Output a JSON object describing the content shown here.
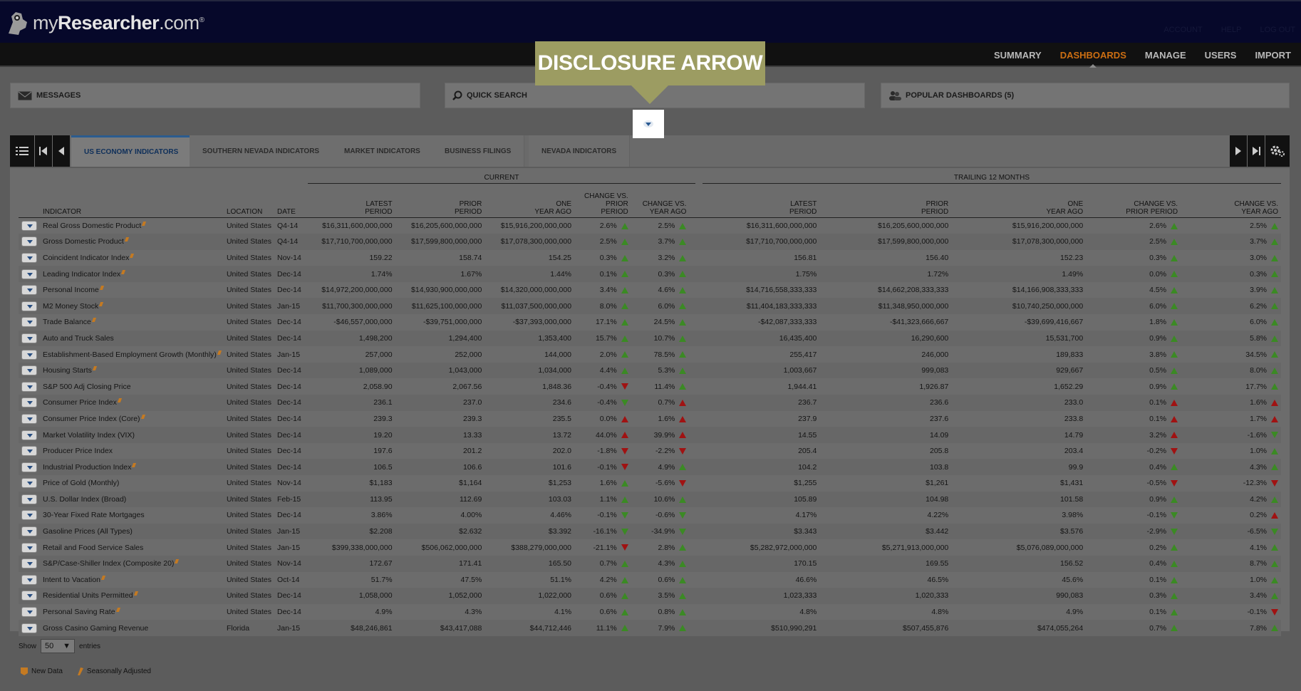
{
  "app": {
    "logo_text_1": "my",
    "logo_text_2": "Researcher",
    "logo_text_3": ".com",
    "logo_reg": "®"
  },
  "top_links": [
    "ACCOUNT",
    "HELP",
    "LOG OUT"
  ],
  "nav": [
    "SUMMARY",
    "DASHBOARDS",
    "MANAGE",
    "USERS",
    "IMPORT"
  ],
  "nav_active": "DASHBOARDS",
  "panels": {
    "messages": "MESSAGES",
    "quick_search": "QUICK SEARCH",
    "popular": "POPULAR DASHBOARDS (5)"
  },
  "callout": "DISCLOSURE ARROW",
  "tabs": [
    "US ECONOMY INDICATORS",
    "SOUTHERN NEVADA INDICATORS",
    "MARKET INDICATORS",
    "BUSINESS FILINGS",
    "NEVADA INDICATORS"
  ],
  "groups": {
    "current": "CURRENT",
    "trailing": "TRAILING 12 MONTHS"
  },
  "columns": {
    "indicator": "INDICATOR",
    "location": "LOCATION",
    "date": "DATE",
    "latest": [
      "LATEST",
      "PERIOD"
    ],
    "prior": [
      "PRIOR",
      "PERIOD"
    ],
    "one_year": [
      "ONE",
      "YEAR AGO"
    ],
    "chg_prior": [
      "CHANGE VS.",
      "PRIOR PERIOD"
    ],
    "chg_year": [
      "CHANGE VS.",
      "YEAR AGO"
    ]
  },
  "rows": [
    [
      "Real Gross Domestic Product",
      1,
      "United States",
      "Q4-14",
      "$16,311,600,000,000",
      "$16,205,600,000,000",
      "$15,916,200,000,000",
      "2.6%",
      "up",
      "2.5%",
      "up",
      "$16,311,600,000,000",
      "$16,205,600,000,000",
      "$15,916,200,000,000",
      "2.6%",
      "up",
      "2.5%",
      "up"
    ],
    [
      "Gross Domestic Product",
      1,
      "United States",
      "Q4-14",
      "$17,710,700,000,000",
      "$17,599,800,000,000",
      "$17,078,300,000,000",
      "2.5%",
      "up",
      "3.7%",
      "up",
      "$17,710,700,000,000",
      "$17,599,800,000,000",
      "$17,078,300,000,000",
      "2.5%",
      "up",
      "3.7%",
      "up"
    ],
    [
      "Coincident Indicator Index",
      1,
      "United States",
      "Nov-14",
      "159.22",
      "158.74",
      "154.25",
      "0.3%",
      "up",
      "3.2%",
      "up",
      "156.81",
      "156.40",
      "152.23",
      "0.3%",
      "up",
      "3.0%",
      "up"
    ],
    [
      "Leading Indicator Index",
      1,
      "United States",
      "Dec-14",
      "1.74%",
      "1.67%",
      "1.44%",
      "0.1%",
      "up",
      "0.3%",
      "up",
      "1.75%",
      "1.72%",
      "1.49%",
      "0.0%",
      "up",
      "0.3%",
      "up"
    ],
    [
      "Personal Income",
      1,
      "United States",
      "Dec-14",
      "$14,972,200,000,000",
      "$14,930,900,000,000",
      "$14,320,000,000,000",
      "3.4%",
      "up",
      "4.6%",
      "up",
      "$14,716,558,333,333",
      "$14,662,208,333,333",
      "$14,166,908,333,333",
      "4.5%",
      "up",
      "3.9%",
      "up"
    ],
    [
      "M2 Money Stock",
      1,
      "United States",
      "Jan-15",
      "$11,700,300,000,000",
      "$11,625,100,000,000",
      "$11,037,500,000,000",
      "8.0%",
      "up",
      "6.0%",
      "up",
      "$11,404,183,333,333",
      "$11,348,950,000,000",
      "$10,740,250,000,000",
      "6.0%",
      "up",
      "6.2%",
      "up"
    ],
    [
      "Trade Balance",
      1,
      "United States",
      "Dec-14",
      "-$46,557,000,000",
      "-$39,751,000,000",
      "-$37,393,000,000",
      "17.1%",
      "up",
      "24.5%",
      "up",
      "-$42,087,333,333",
      "-$41,323,666,667",
      "-$39,699,416,667",
      "1.8%",
      "up",
      "6.0%",
      "up"
    ],
    [
      "Auto and Truck Sales",
      0,
      "United States",
      "Dec-14",
      "1,498,200",
      "1,294,400",
      "1,353,400",
      "15.7%",
      "up",
      "10.7%",
      "up",
      "16,435,400",
      "16,290,600",
      "15,531,700",
      "0.9%",
      "up",
      "5.8%",
      "up"
    ],
    [
      "Establishment-Based Employment Growth (Monthly)",
      1,
      "United States",
      "Jan-15",
      "257,000",
      "252,000",
      "144,000",
      "2.0%",
      "up",
      "78.5%",
      "up",
      "255,417",
      "246,000",
      "189,833",
      "3.8%",
      "up",
      "34.5%",
      "up"
    ],
    [
      "Housing Starts",
      1,
      "United States",
      "Dec-14",
      "1,089,000",
      "1,043,000",
      "1,034,000",
      "4.4%",
      "up",
      "5.3%",
      "up",
      "1,003,667",
      "999,083",
      "929,667",
      "0.5%",
      "up",
      "8.0%",
      "up"
    ],
    [
      "S&P 500 Adj Closing Price",
      0,
      "United States",
      "Dec-14",
      "2,058.90",
      "2,067.56",
      "1,848.36",
      "-0.4%",
      "dn",
      "11.4%",
      "up",
      "1,944.41",
      "1,926.87",
      "1,652.29",
      "0.9%",
      "up",
      "17.7%",
      "up"
    ],
    [
      "Consumer Price Index",
      1,
      "United States",
      "Dec-14",
      "236.1",
      "237.0",
      "234.6",
      "-0.4%",
      "dng",
      "0.7%",
      "upr",
      "236.7",
      "236.6",
      "233.0",
      "0.1%",
      "upr",
      "1.6%",
      "upr"
    ],
    [
      "Consumer Price Index (Core)",
      1,
      "United States",
      "Dec-14",
      "239.3",
      "239.3",
      "235.5",
      "0.0%",
      "upr",
      "1.6%",
      "upr",
      "237.9",
      "237.6",
      "233.8",
      "0.1%",
      "upr",
      "1.7%",
      "upr"
    ],
    [
      "Market Volatility Index (VIX)",
      0,
      "United States",
      "Dec-14",
      "19.20",
      "13.33",
      "13.72",
      "44.0%",
      "upr",
      "39.9%",
      "upr",
      "14.55",
      "14.09",
      "14.79",
      "3.2%",
      "upr",
      "-1.6%",
      "dng"
    ],
    [
      "Producer Price Index",
      0,
      "United States",
      "Dec-14",
      "197.6",
      "201.2",
      "202.0",
      "-1.8%",
      "dn",
      "-2.2%",
      "dn",
      "205.4",
      "205.8",
      "203.4",
      "-0.2%",
      "dn",
      "1.0%",
      "up"
    ],
    [
      "Industrial Production Index",
      1,
      "United States",
      "Dec-14",
      "106.5",
      "106.6",
      "101.6",
      "-0.1%",
      "dn",
      "4.9%",
      "up",
      "104.2",
      "103.8",
      "99.9",
      "0.4%",
      "up",
      "4.3%",
      "up"
    ],
    [
      "Price of Gold (Monthly)",
      0,
      "United States",
      "Nov-14",
      "$1,183",
      "$1,164",
      "$1,253",
      "1.6%",
      "up",
      "-5.6%",
      "dn",
      "$1,255",
      "$1,261",
      "$1,431",
      "-0.5%",
      "dn",
      "-12.3%",
      "dn"
    ],
    [
      "U.S. Dollar Index (Broad)",
      0,
      "United States",
      "Feb-15",
      "113.95",
      "112.69",
      "103.03",
      "1.1%",
      "up",
      "10.6%",
      "up",
      "105.89",
      "104.98",
      "101.58",
      "0.9%",
      "up",
      "4.2%",
      "up"
    ],
    [
      "30-Year Fixed Rate Mortgages",
      0,
      "United States",
      "Dec-14",
      "3.86%",
      "4.00%",
      "4.46%",
      "-0.1%",
      "dng",
      "-0.6%",
      "dng",
      "4.17%",
      "4.22%",
      "3.98%",
      "-0.1%",
      "dng",
      "0.2%",
      "upr"
    ],
    [
      "Gasoline Prices (All Types)",
      0,
      "United States",
      "Jan-15",
      "$2.208",
      "$2.632",
      "$3.392",
      "-16.1%",
      "dng",
      "-34.9%",
      "dng",
      "$3.343",
      "$3.442",
      "$3.576",
      "-2.9%",
      "dng",
      "-6.5%",
      "dng"
    ],
    [
      "Retail and Food Service Sales",
      0,
      "United States",
      "Jan-15",
      "$399,338,000,000",
      "$506,062,000,000",
      "$388,279,000,000",
      "-21.1%",
      "dn",
      "2.8%",
      "up",
      "$5,282,972,000,000",
      "$5,271,913,000,000",
      "$5,076,089,000,000",
      "0.2%",
      "up",
      "4.1%",
      "up"
    ],
    [
      "S&P/Case-Shiller Index (Composite 20)",
      1,
      "United States",
      "Nov-14",
      "172.67",
      "171.41",
      "165.50",
      "0.7%",
      "up",
      "4.3%",
      "up",
      "170.15",
      "169.55",
      "156.52",
      "0.4%",
      "up",
      "8.7%",
      "up"
    ],
    [
      "Intent to Vacation",
      1,
      "United States",
      "Oct-14",
      "51.7%",
      "47.5%",
      "51.1%",
      "4.2%",
      "up",
      "0.6%",
      "up",
      "46.6%",
      "46.5%",
      "45.6%",
      "0.1%",
      "up",
      "1.0%",
      "up"
    ],
    [
      "Residential Units Permitted",
      1,
      "United States",
      "Dec-14",
      "1,058,000",
      "1,052,000",
      "1,022,000",
      "0.6%",
      "up",
      "3.5%",
      "up",
      "1,023,333",
      "1,020,333",
      "990,083",
      "0.3%",
      "up",
      "3.4%",
      "up"
    ],
    [
      "Personal Saving Rate",
      1,
      "United States",
      "Dec-14",
      "4.9%",
      "4.3%",
      "4.1%",
      "0.6%",
      "up",
      "0.8%",
      "up",
      "4.8%",
      "4.8%",
      "4.9%",
      "0.1%",
      "up",
      "-0.1%",
      "dn"
    ],
    [
      "Gross Casino Gaming Revenue",
      0,
      "Florida",
      "Jan-15",
      "$48,246,861",
      "$43,417,088",
      "$44,712,446",
      "11.1%",
      "up",
      "7.9%",
      "up",
      "$510,990,291",
      "$507,455,876",
      "$474,055,264",
      "0.7%",
      "up",
      "7.8%",
      "up"
    ]
  ],
  "show": {
    "label_before": "Show",
    "value": "50",
    "label_after": "entries"
  },
  "legend": {
    "new_data": "New Data",
    "seasonally": "Seasonally Adjusted"
  }
}
